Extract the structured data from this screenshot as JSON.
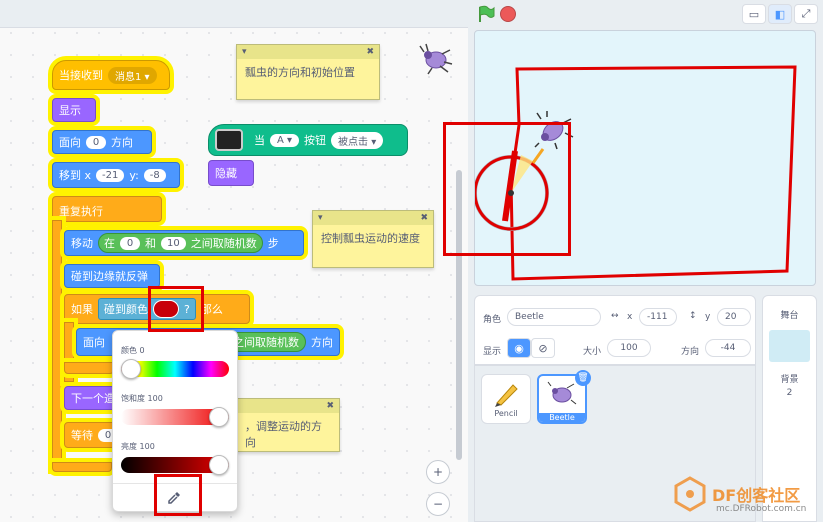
{
  "blocks": {
    "when_receive": "当接收到",
    "message": "消息1 ▾",
    "show": "显示",
    "point": "面向",
    "point_val": "0",
    "direction": "方向",
    "goto": "移到 x",
    "goto_x": "-21",
    "goto_y_label": "y:",
    "goto_y": "-8",
    "forever": "重复执行",
    "move": "移动",
    "move_in": "在",
    "move_from": "0",
    "move_and": "和",
    "move_to": "10",
    "move_random": "之间取随机数",
    "move_steps": "步",
    "bounce": "碰到边缘就反弹",
    "if": "如果",
    "touching": "碰到颜色",
    "touching_q": "?",
    "then": "那么",
    "point2": "面向",
    "point2_random": "之间取随机数",
    "point2_dir": "方向",
    "next_costume": "下一个造",
    "wait": "等待",
    "wait_val": "0",
    "when_btn": "当",
    "btn_a": "A ▾",
    "btn_label": "按钮",
    "btn_pressed": "被点击 ▾",
    "hide": "隐藏"
  },
  "notes": {
    "n1": "瓢虫的方向和初始位置",
    "n2": "控制瓢虫运动的速度",
    "n3": "，调整运动的方向",
    "arrow": "▾",
    "close": "✖"
  },
  "picker": {
    "color_label": "颜色",
    "color_val": "0",
    "sat_label": "饱和度",
    "sat_val": "100",
    "bright_label": "亮度",
    "bright_val": "100",
    "color_level": 0,
    "sat_level": 100,
    "bright_level": 100
  },
  "sprite_info": {
    "sprite_label": "角色",
    "sprite_name": "Beetle",
    "x_label": "x",
    "x_val": "-111",
    "y_label": "y",
    "y_val": "20",
    "show_label": "显示",
    "size_label": "大小",
    "size_val": "100",
    "dir_label": "方向",
    "dir_val": "-44"
  },
  "sprites": [
    "Pencil",
    "Beetle"
  ],
  "stage_panel": {
    "title": "舞台",
    "backdrop_label": "背景",
    "backdrop_count": "2"
  },
  "zoom": {
    "in": "+",
    "out": "−"
  },
  "watermark": {
    "logo": "DF创客社区",
    "url": "mc.DFRobot.com.cn"
  },
  "colors": {
    "accent": "#4c97ff",
    "highlight": "#e00000",
    "selected_color": "#c8000a"
  }
}
